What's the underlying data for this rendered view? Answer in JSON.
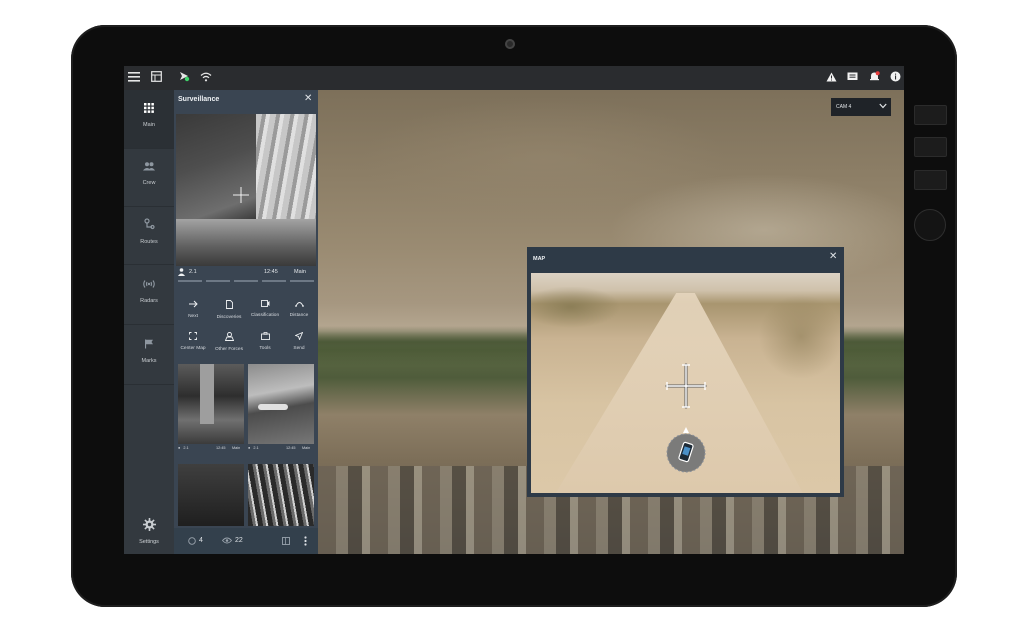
{
  "topbar": {
    "left_icons": [
      "menu-icon",
      "table-icon",
      "drone-icon",
      "wifi-icon"
    ],
    "right_icons": [
      "warning-icon",
      "chat-icon",
      "alert-bell-icon",
      "info-icon"
    ]
  },
  "nav": {
    "items": [
      {
        "label": "Main",
        "icon": "grid-icon"
      },
      {
        "label": "Crew",
        "icon": "crew-icon"
      },
      {
        "label": "Routes",
        "icon": "route-icon"
      },
      {
        "label": "Radars",
        "icon": "radar-icon"
      },
      {
        "label": "Marks",
        "icon": "flag-icon"
      }
    ],
    "settings_label": "Settings"
  },
  "surveillance": {
    "title": "Surveillance",
    "feed": {
      "count": "2.1",
      "time": "12:45",
      "name": "Main"
    },
    "tools": [
      {
        "label": "Next",
        "icon": "arrow-right-icon"
      },
      {
        "label": "Discoveries",
        "icon": "document-icon"
      },
      {
        "label": "Classification",
        "icon": "camera-icon"
      },
      {
        "label": "Distance",
        "icon": "distance-icon"
      },
      {
        "label": "Center Map",
        "icon": "center-icon"
      },
      {
        "label": "Other Forces",
        "icon": "forces-icon"
      },
      {
        "label": "Tools",
        "icon": "toolbox-icon"
      },
      {
        "label": "Send",
        "icon": "send-icon"
      }
    ],
    "thumbs": [
      {
        "count": "2.1",
        "time": "12:45",
        "name": "Main"
      },
      {
        "count": "2.1",
        "time": "12:45",
        "name": "Main"
      }
    ],
    "footer": {
      "targets": "4",
      "views": "22"
    }
  },
  "cam": {
    "selected": "CAM 4"
  },
  "map": {
    "title": "MAP"
  }
}
